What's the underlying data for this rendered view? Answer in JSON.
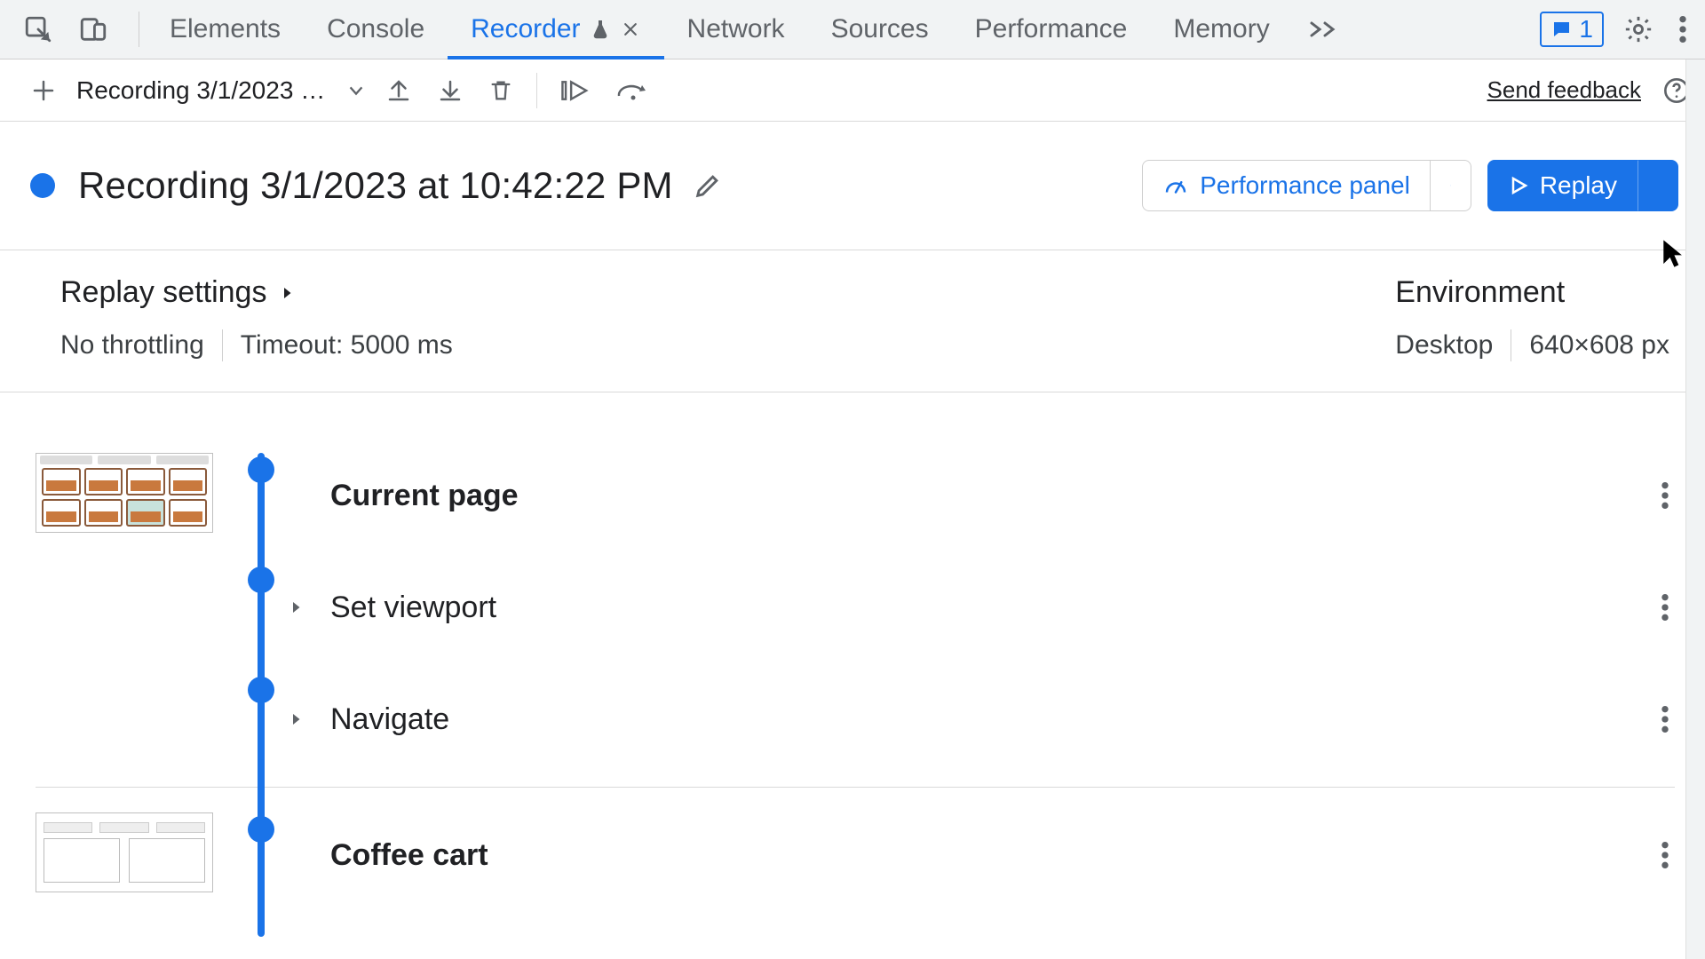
{
  "tabstrip": {
    "tabs": [
      {
        "label": "Elements"
      },
      {
        "label": "Console"
      },
      {
        "label": "Recorder"
      },
      {
        "label": "Network"
      },
      {
        "label": "Sources"
      },
      {
        "label": "Performance"
      },
      {
        "label": "Memory"
      }
    ],
    "issues_count": "1"
  },
  "toolbar": {
    "recording_select": "Recording 3/1/2023 at 10…",
    "send_feedback": "Send feedback"
  },
  "heading": {
    "title": "Recording 3/1/2023 at 10:42:22 PM",
    "perf_label": "Performance panel",
    "replay_label": "Replay"
  },
  "settings": {
    "header": "Replay settings",
    "throttling": "No throttling",
    "timeout": "Timeout: 5000 ms"
  },
  "environment": {
    "header": "Environment",
    "device": "Desktop",
    "viewport": "640×608 px"
  },
  "steps_block1": {
    "title": "Current page",
    "row2": "Set viewport",
    "row3": "Navigate"
  },
  "steps_block2": {
    "title": "Coffee cart"
  },
  "colors": {
    "accent": "#1a73e8"
  }
}
